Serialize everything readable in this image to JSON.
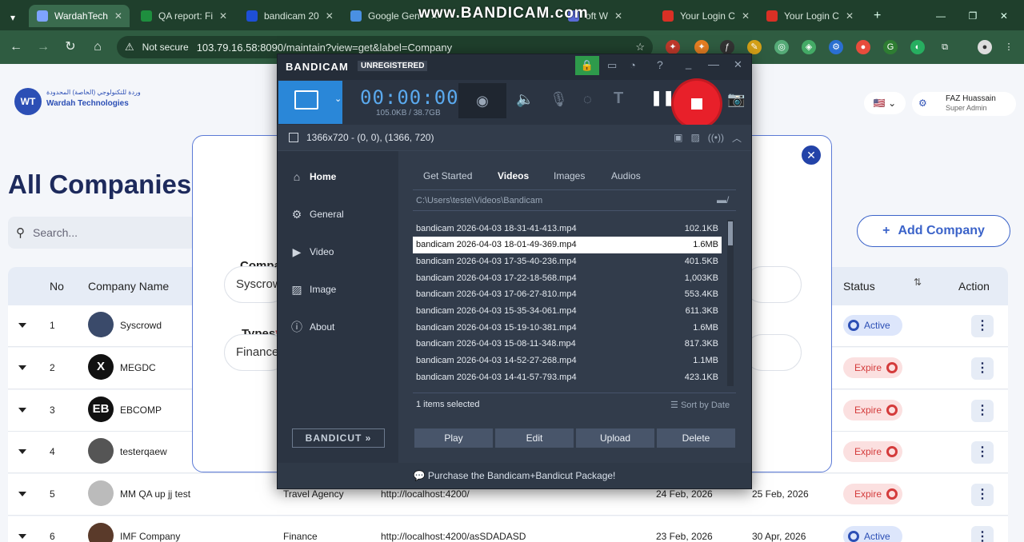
{
  "watermark": "www.BANDICAM.com",
  "browser": {
    "tabs": [
      {
        "label": "WardahTech",
        "fav": "#7ea3ff"
      },
      {
        "label": "QA report: Fi",
        "fav": "#1e8e3e"
      },
      {
        "label": "bandicam 20",
        "fav": "#1e4fd6"
      },
      {
        "label": "Google Gen",
        "fav": "#4a90e2"
      },
      {
        "label": "oft W",
        "fav": "#5a6bd6"
      },
      {
        "label": "Your Login C",
        "fav": "#d93025"
      },
      {
        "label": "Your Login C",
        "fav": "#d93025"
      }
    ],
    "security": "Not secure",
    "url": "103.79.16.58:8090/maintain?view=get&label=Company"
  },
  "app": {
    "logo_text": "Wardah Technologies",
    "logo_arabic": "وردة للتكنولوجي (الخاصة) المحدودة",
    "user_name": "FAZ Huassain",
    "user_role": "Super Admin",
    "page_title": "All Companies",
    "search_placeholder": "Search...",
    "add_button": "Add Company",
    "columns": {
      "no": "No",
      "name": "Company Name",
      "status": "Status",
      "action": "Action"
    },
    "rows": [
      {
        "no": "1",
        "name": "Syscrowd",
        "av": "#3a4a6a",
        "avtext": "",
        "type": "",
        "url": "",
        "start": "",
        "end": "",
        "status": "Active"
      },
      {
        "no": "2",
        "name": "MEGDC",
        "av": "#111",
        "avtext": "X",
        "type": "",
        "url": "",
        "start": "",
        "end": "",
        "status": "Expire"
      },
      {
        "no": "3",
        "name": "EBCOMP",
        "av": "#111",
        "avtext": "EB",
        "type": "",
        "url": "",
        "start": "",
        "end": "",
        "status": "Expire"
      },
      {
        "no": "4",
        "name": "testerqaew",
        "av": "#555",
        "avtext": "",
        "type": "",
        "url": "",
        "start": "",
        "end": "",
        "status": "Expire"
      },
      {
        "no": "5",
        "name": "MM QA up jj test",
        "av": "#bbb",
        "avtext": "",
        "type": "Travel Agency",
        "url": "http://localhost:4200/",
        "start": "24 Feb, 2026",
        "end": "25 Feb, 2026",
        "status": "Expire"
      },
      {
        "no": "6",
        "name": "IMF Company",
        "av": "#5a3a2a",
        "avtext": "",
        "type": "Finance",
        "url": "http://localhost:4200/asSDADASD",
        "start": "23 Feb, 2026",
        "end": "30 Apr, 2026",
        "status": "Active"
      }
    ],
    "modal": {
      "company_label": "Compa",
      "company_value": "Syscrow",
      "types_label": "Types",
      "types_required": "*",
      "types_value": "Finance"
    }
  },
  "bandicam": {
    "logo": "BANDICAM",
    "unregistered": "UNREGISTERED",
    "timer": "00:00:00",
    "size": "105.0KB / 38.7GB",
    "resolution": "1366x720 - (0, 0), (1366, 720)",
    "sidebar": [
      "Home",
      "General",
      "Video",
      "Image",
      "About"
    ],
    "bandicut": "BANDICUT",
    "tabs": [
      "Get Started",
      "Videos",
      "Images",
      "Audios"
    ],
    "active_tab": "Videos",
    "path": "C:\\Users\\teste\\Videos\\Bandicam",
    "files": [
      {
        "name": "bandicam 2026-04-03 18-31-41-413.mp4",
        "size": "102.1KB"
      },
      {
        "name": "bandicam 2026-04-03 18-01-49-369.mp4",
        "size": "1.6MB"
      },
      {
        "name": "bandicam 2026-04-03 17-35-40-236.mp4",
        "size": "401.5KB"
      },
      {
        "name": "bandicam 2026-04-03 17-22-18-568.mp4",
        "size": "1,003KB"
      },
      {
        "name": "bandicam 2026-04-03 17-06-27-810.mp4",
        "size": "553.4KB"
      },
      {
        "name": "bandicam 2026-04-03 15-35-34-061.mp4",
        "size": "611.3KB"
      },
      {
        "name": "bandicam 2026-04-03 15-19-10-381.mp4",
        "size": "1.6MB"
      },
      {
        "name": "bandicam 2026-04-03 15-08-11-348.mp4",
        "size": "817.3KB"
      },
      {
        "name": "bandicam 2026-04-03 14-52-27-268.mp4",
        "size": "1.1MB"
      },
      {
        "name": "bandicam 2026-04-03 14-41-57-793.mp4",
        "size": "423.1KB"
      }
    ],
    "selected_index": 1,
    "selection_info": "1 items selected",
    "sort_label": "Sort by Date",
    "actions": [
      "Play",
      "Edit",
      "Upload",
      "Delete"
    ],
    "footer": "Purchase the Bandicam+Bandicut Package!"
  }
}
